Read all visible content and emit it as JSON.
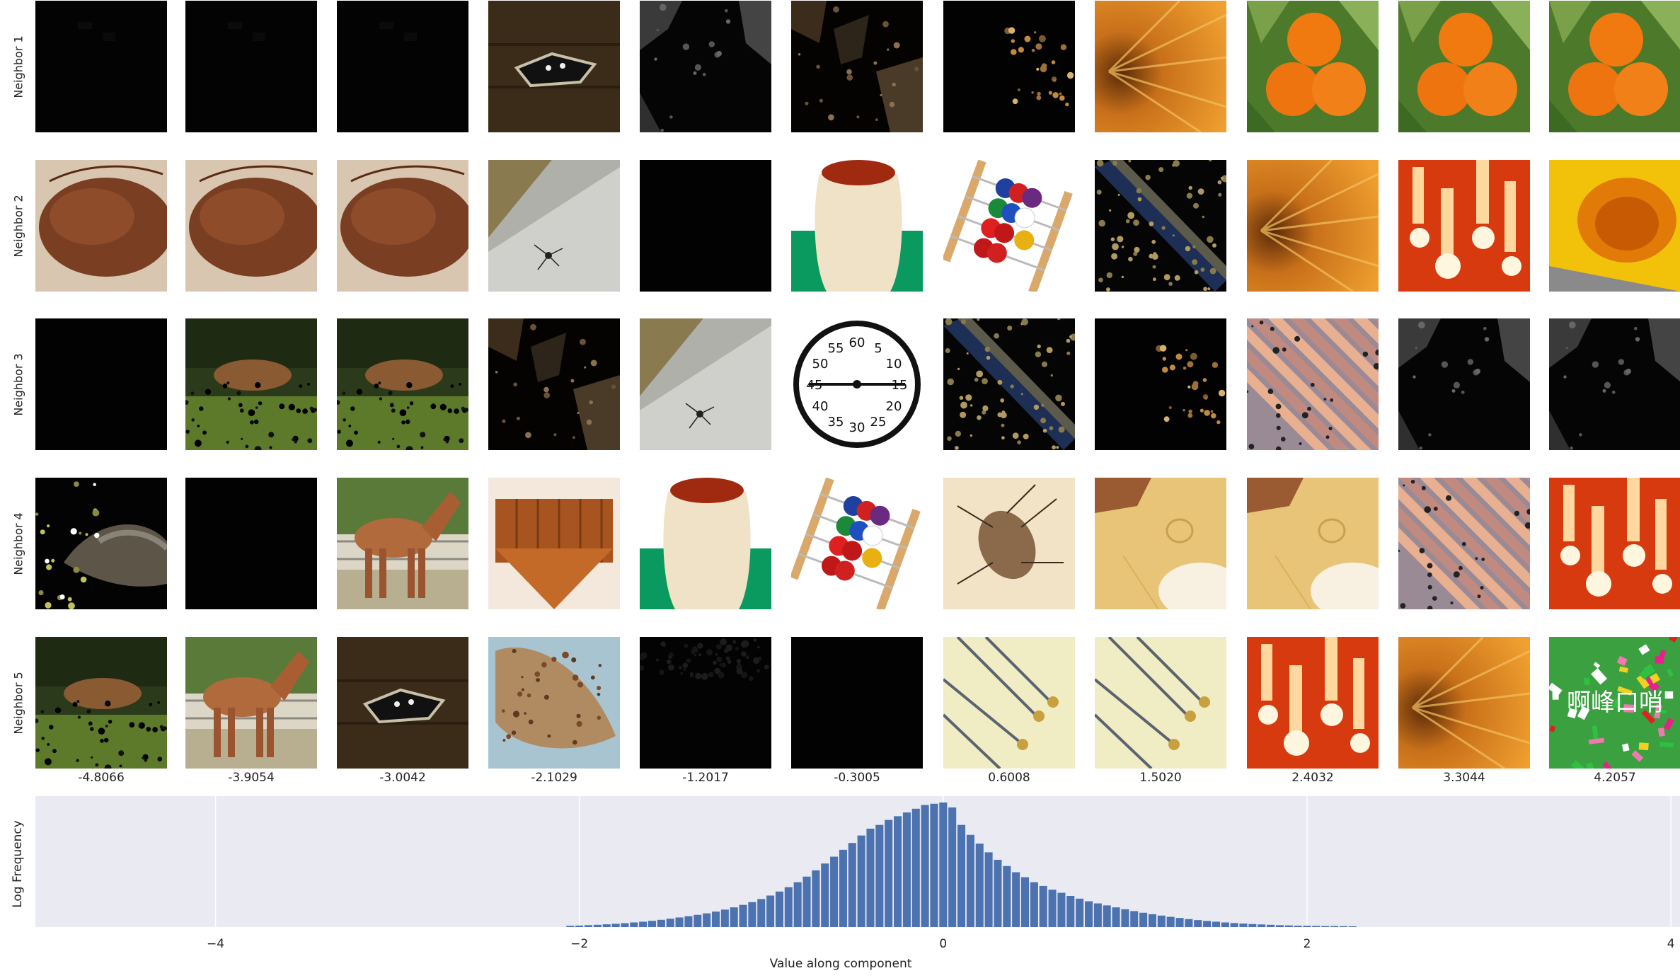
{
  "row_labels": [
    "Neighbor 1",
    "Neighbor 2",
    "Neighbor 3",
    "Neighbor 4",
    "Neighbor 5"
  ],
  "column_values": [
    "-4.8066",
    "-3.9054",
    "-3.0042",
    "-2.1029",
    "-1.2017",
    "-0.3005",
    "0.6008",
    "1.5020",
    "2.4032",
    "3.3044",
    "4.2057"
  ],
  "thumbnails": [
    [
      "masked-dark",
      "masked-dark",
      "masked-dark",
      "wood-floor-object",
      "masked-dark-grey",
      "masked-dark-brown",
      "masked-dark-speckle",
      "orange-slice",
      "tangerines",
      "tangerines",
      "tangerines"
    ],
    [
      "brown-fur",
      "brown-fur",
      "brown-fur",
      "concrete-spider",
      "dark",
      "cream-vase",
      "abacus-toy",
      "masked-dark-diagonal",
      "orange-slice",
      "candle-lights",
      "yellow-mango"
    ],
    [
      "dark",
      "masked-deer-grass",
      "masked-deer-grass",
      "masked-dark-brown",
      "concrete-spider",
      "clock-dial",
      "masked-dark-diagonal",
      "masked-dark-speckle",
      "roof-tiles",
      "masked-dark-grey",
      "masked-dark-grey"
    ],
    [
      "masked-squirrel",
      "dark",
      "brown-horse",
      "wooden-cradle",
      "cream-vase",
      "abacus-toy",
      "weevil-insect",
      "table-plates",
      "table-plates",
      "roof-tiles",
      "candle-lights"
    ],
    [
      "masked-deer-grass",
      "brown-horse",
      "wood-floor-object",
      "fish-pattern",
      "masked-dark-dots",
      "dark",
      "safety-pins",
      "safety-pins",
      "candle-lights",
      "orange-slice",
      "candy-pile"
    ]
  ],
  "candy_text": "啊峰口哨",
  "clock_numbers": [
    "60",
    "5",
    "10",
    "15",
    "20",
    "25",
    "30",
    "35",
    "40",
    "45",
    "50",
    "55"
  ],
  "chart_data": {
    "type": "bar",
    "title": "",
    "xlabel": "Value along component",
    "ylabel": "Log Frequency",
    "xlim": [
      -4.99,
      4.05
    ],
    "xticks": [
      -4,
      -2,
      0,
      2,
      4
    ],
    "xtick_labels": [
      "−4",
      "−2",
      "0",
      "2",
      "4"
    ],
    "y_scale": "log",
    "grid": true,
    "bar_color": "#4c72b0",
    "background": "#eaeaf2",
    "bin_width": 0.05,
    "x": [
      -2.05,
      -2.0,
      -1.95,
      -1.9,
      -1.85,
      -1.8,
      -1.75,
      -1.7,
      -1.65,
      -1.6,
      -1.55,
      -1.5,
      -1.45,
      -1.4,
      -1.35,
      -1.3,
      -1.25,
      -1.2,
      -1.15,
      -1.1,
      -1.05,
      -1.0,
      -0.95,
      -0.9,
      -0.85,
      -0.8,
      -0.75,
      -0.7,
      -0.65,
      -0.6,
      -0.55,
      -0.5,
      -0.45,
      -0.4,
      -0.35,
      -0.3,
      -0.25,
      -0.2,
      -0.15,
      -0.1,
      -0.05,
      0.0,
      0.05,
      0.1,
      0.15,
      0.2,
      0.25,
      0.3,
      0.35,
      0.4,
      0.45,
      0.5,
      0.55,
      0.6,
      0.65,
      0.7,
      0.75,
      0.8,
      0.85,
      0.9,
      0.95,
      1.0,
      1.05,
      1.1,
      1.15,
      1.2,
      1.25,
      1.3,
      1.35,
      1.4,
      1.45,
      1.5,
      1.55,
      1.6,
      1.65,
      1.7,
      1.75,
      1.8,
      1.85,
      1.9,
      1.95,
      2.0,
      2.05,
      2.1,
      2.15,
      2.2,
      2.25
    ],
    "log_heights": [
      0.01,
      0.012,
      0.015,
      0.018,
      0.022,
      0.026,
      0.031,
      0.037,
      0.043,
      0.05,
      0.058,
      0.067,
      0.077,
      0.087,
      0.098,
      0.11,
      0.124,
      0.14,
      0.158,
      0.178,
      0.2,
      0.225,
      0.253,
      0.285,
      0.32,
      0.36,
      0.405,
      0.455,
      0.51,
      0.565,
      0.62,
      0.675,
      0.735,
      0.79,
      0.82,
      0.86,
      0.89,
      0.92,
      0.95,
      0.98,
      0.99,
      1.0,
      0.96,
      0.82,
      0.74,
      0.67,
      0.6,
      0.54,
      0.49,
      0.44,
      0.4,
      0.36,
      0.33,
      0.3,
      0.275,
      0.25,
      0.228,
      0.207,
      0.19,
      0.174,
      0.158,
      0.143,
      0.128,
      0.115,
      0.103,
      0.092,
      0.082,
      0.073,
      0.064,
      0.056,
      0.049,
      0.043,
      0.037,
      0.032,
      0.028,
      0.024,
      0.021,
      0.018,
      0.015,
      0.013,
      0.011,
      0.01,
      0.009,
      0.008,
      0.008,
      0.007,
      0.006
    ]
  }
}
